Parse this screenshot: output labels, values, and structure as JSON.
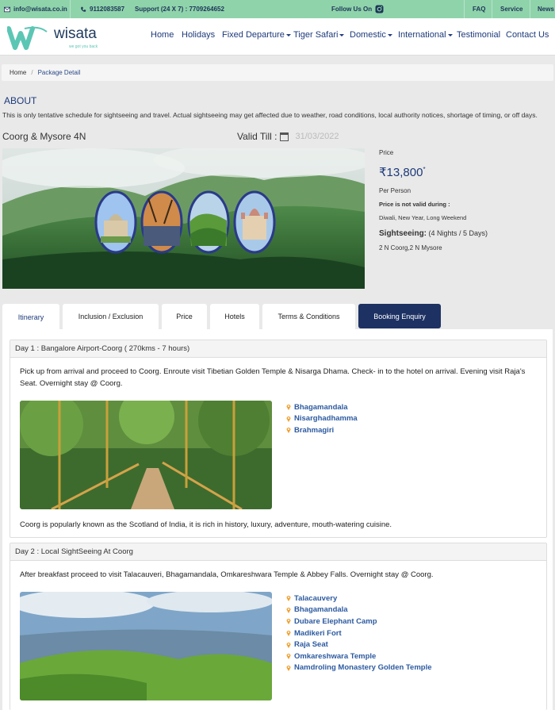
{
  "topbar": {
    "email": "info@wisata.co.in",
    "phone": "9112083587",
    "support": "Support (24 X 7) : 7709264652",
    "follow": "Follow Us On",
    "links": [
      "FAQ",
      "Service",
      "News"
    ]
  },
  "brand": {
    "name": "wisata",
    "tagline": "we got you back"
  },
  "nav": [
    "Home",
    "Holidays",
    "Fixed Departure",
    "Tiger Safari",
    "Domestic",
    "International",
    "Testimonial",
    "Contact Us"
  ],
  "breadcrumb": {
    "home": "Home",
    "sep": "/",
    "current": "Package Detail"
  },
  "about": {
    "heading": "ABOUT",
    "text": "This is only tentative schedule for sightseeing and travel. Actual sightseeing may get affected due to weather, road conditions, local authority notices, shortage of timing, or off days."
  },
  "package": {
    "title": "Coorg & Mysore 4N",
    "valid_label": "Valid Till :",
    "valid_date": "31/03/2022"
  },
  "pricing": {
    "price_label": "Price",
    "amount": "₹13,800",
    "asterisk": "*",
    "per": "Per Person",
    "not_valid_label": "Price is not valid during :",
    "not_valid_text": "Diwali, New Year, Long Weekend",
    "sightseeing_label": "Sightseeing:",
    "sightseeing_duration": "(4 Nights / 5 Days)",
    "route": "2 N Coorg,2 N Mysore"
  },
  "tabs": [
    "Itinerary",
    "Inclusion / Exclusion",
    "Price",
    "Hotels",
    "Terms & Conditions",
    "Booking Enquiry"
  ],
  "days": [
    {
      "title": "Day 1 : Bangalore Airport-Coorg ( 270kms - 7 hours)",
      "description": "Pick up from arrival and proceed to Coorg. Enroute visit Tibetian Golden Temple & Nisarga Dhama. Check- in to the hotel on arrival. Evening visit Raja's Seat. Overnight stay @ Coorg.",
      "places": [
        "Bhagamandala",
        "Nisarghadhamma",
        "Brahmagiri"
      ],
      "note": "Coorg is popularly known as the Scotland of India, it is rich in history, luxury, adventure, mouth-watering cuisine."
    },
    {
      "title": "Day 2 : Local SightSeeing At Coorg",
      "description": "After breakfast proceed to visit Talacauveri, Bhagamandala, Omkareshwara Temple & Abbey Falls. Overnight stay @ Coorg.",
      "places": [
        "Talacauvery",
        "Bhagamandala",
        "Dubare Elephant Camp",
        "Madikeri Fort",
        "Raja Seat",
        "Omkareshwara Temple",
        "Namdroling Monastery Golden Temple"
      ]
    }
  ],
  "colors": {
    "topbar": "#8fd3ab",
    "navy": "#1d3163",
    "link": "#2c5aa0",
    "pin": "#f0a030"
  }
}
